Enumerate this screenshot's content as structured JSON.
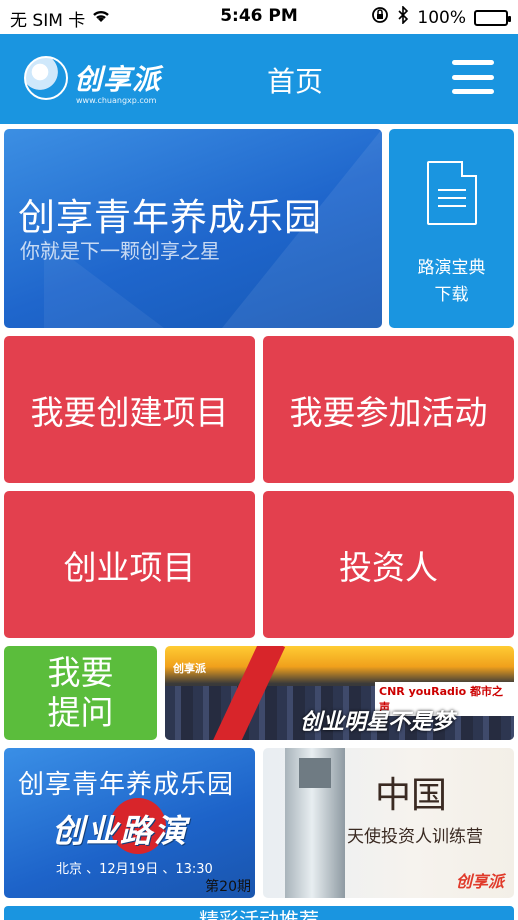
{
  "status": {
    "carrier": "无 SIM 卡",
    "time": "5:46 PM",
    "battery": "100%",
    "battery_level": 1.0
  },
  "navbar": {
    "logo_text": "创享派",
    "logo_url": "www.chuangxp.com",
    "title": "首页"
  },
  "banner": {
    "title": "创享青年养成乐园",
    "subtitle": "你就是下一颗创享之星"
  },
  "download": {
    "label_line1": "路演宝典",
    "label_line2": "下载"
  },
  "tiles": {
    "create_project": "我要创建项目",
    "join_activity": "我要参加活动",
    "projects": "创业项目",
    "investors": "投资人",
    "ask_line1": "我要",
    "ask_line2": "提问"
  },
  "ad_star": {
    "logo": "创享派",
    "radio": "CNR youRadio 都市之声",
    "slogan": "创业明星不是梦"
  },
  "ad_roadshow": {
    "title": "创享青年养成乐园",
    "big": "创业路演",
    "info": "北京 、12月19日 、13:30",
    "issue": "第20期"
  },
  "ad_angel": {
    "title": "中国",
    "subtitle": "天使投资人训练营",
    "brand": "创享派"
  },
  "bottom": {
    "label": "精彩活动推荐"
  },
  "colors": {
    "nav_blue": "#1a95e0",
    "tile_red": "#e3404e",
    "tile_green": "#5bbd3c"
  }
}
